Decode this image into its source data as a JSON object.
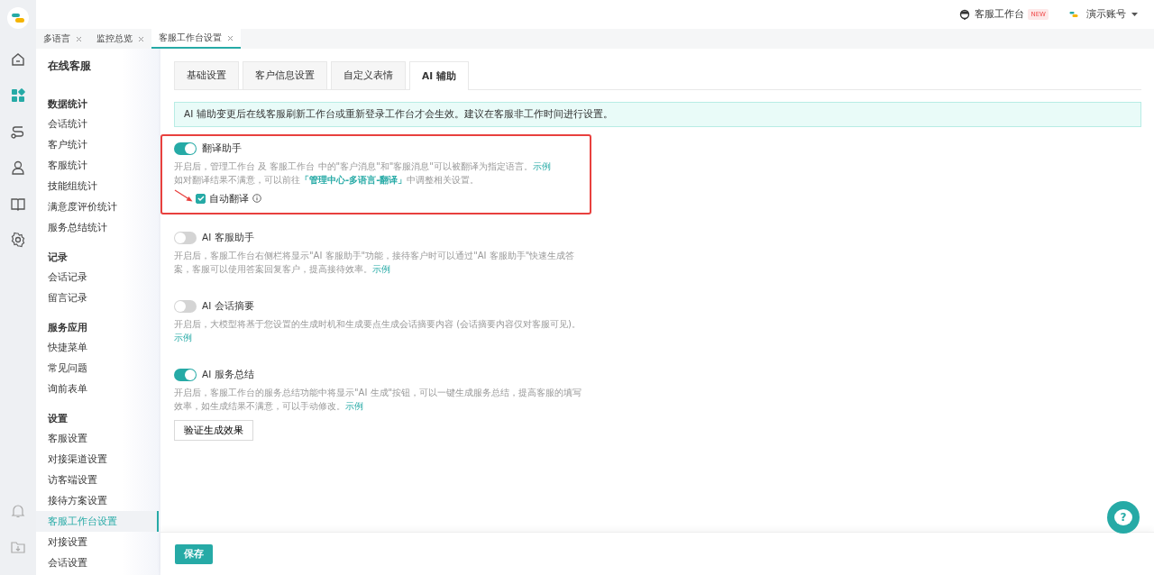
{
  "header": {
    "workbench": {
      "label": "客服工作台",
      "badge": "NEW"
    },
    "account": {
      "label": "演示账号"
    }
  },
  "rail": [
    {
      "kind": "home",
      "selected": false
    },
    {
      "kind": "apps",
      "selected": true
    },
    {
      "kind": "flow",
      "selected": false
    },
    {
      "kind": "person",
      "selected": false
    },
    {
      "kind": "book",
      "selected": false
    },
    {
      "kind": "gear",
      "selected": false
    }
  ],
  "rail_bottom": [
    {
      "kind": "bell"
    },
    {
      "kind": "download"
    }
  ],
  "page_tabs": [
    {
      "label": "多语言",
      "selected": false
    },
    {
      "label": "监控总览",
      "selected": false
    },
    {
      "label": "客服工作台设置",
      "selected": true
    }
  ],
  "sidebar": {
    "title": "在线客服",
    "groups": [
      {
        "title": "数据统计",
        "items": [
          {
            "label": "会话统计",
            "selected": false
          },
          {
            "label": "客户统计",
            "selected": false
          },
          {
            "label": "客服统计",
            "selected": false
          },
          {
            "label": "技能组统计",
            "selected": false
          },
          {
            "label": "满意度评价统计",
            "selected": false
          },
          {
            "label": "服务总结统计",
            "selected": false
          }
        ]
      },
      {
        "title": "记录",
        "items": [
          {
            "label": "会话记录",
            "selected": false
          },
          {
            "label": "留言记录",
            "selected": false
          }
        ]
      },
      {
        "title": "服务应用",
        "items": [
          {
            "label": "快捷菜单",
            "selected": false
          },
          {
            "label": "常见问题",
            "selected": false
          },
          {
            "label": "询前表单",
            "selected": false
          }
        ]
      },
      {
        "title": "设置",
        "items": [
          {
            "label": "客服设置",
            "selected": false
          },
          {
            "label": "对接渠道设置",
            "selected": false
          },
          {
            "label": "访客端设置",
            "selected": false
          },
          {
            "label": "接待方案设置",
            "selected": false
          },
          {
            "label": "客服工作台设置",
            "selected": true
          },
          {
            "label": "对接设置",
            "selected": false
          },
          {
            "label": "会话设置",
            "selected": false
          }
        ]
      }
    ]
  },
  "tabs": [
    {
      "label": "基础设置",
      "selected": false
    },
    {
      "label": "客户信息设置",
      "selected": false
    },
    {
      "label": "自定义表情",
      "selected": false
    },
    {
      "label": "AI 辅助",
      "selected": true
    }
  ],
  "notice": "AI 辅助变更后在线客服刷新工作台或重新登录工作台才会生效。建议在客服非工作时间进行设置。",
  "features": [
    {
      "title": "翻译助手",
      "on": true,
      "highlighted": true,
      "lines": [
        [
          {
            "kind": "text",
            "text": "开启后，管理工作台 及 客服工作台 中的\"客户消息\"和\"客服消息\"可以被翻译为指定语言。"
          },
          {
            "kind": "link",
            "text": "示例"
          }
        ],
        [
          {
            "kind": "text",
            "text": "如对翻译结果不满意，可以前往"
          },
          {
            "kind": "link",
            "text": "「管理中心-多语言-翻译」"
          },
          {
            "kind": "text",
            "text": "中调整相关设置。"
          }
        ]
      ],
      "option": {
        "label": "自动翻译",
        "checked": true
      }
    },
    {
      "title": "AI 客服助手",
      "on": false,
      "lines": [
        [
          {
            "kind": "text",
            "text": "开启后，客服工作台右侧栏将显示\"AI 客服助手\"功能，接待客户时可以通过\"AI 客服助手\"快速生成答案，客服可以使用答案回复客户，提高接待效率。"
          },
          {
            "kind": "link",
            "text": "示例"
          }
        ]
      ]
    },
    {
      "title": "AI 会话摘要",
      "on": false,
      "lines": [
        [
          {
            "kind": "text",
            "text": "开启后，大模型将基于您设置的生成时机和生成要点生成会话摘要内容 (会话摘要内容仅对客服可见)。"
          },
          {
            "kind": "link",
            "text": "示例"
          }
        ]
      ]
    },
    {
      "title": "AI 服务总结",
      "on": true,
      "lines": [
        [
          {
            "kind": "text",
            "text": "开启后，客服工作台的服务总结功能中将显示\"AI 生成\"按钮，可以一键生成服务总结，提高客服的填写效率，如生成结果不满意，可以手动修改。"
          },
          {
            "kind": "link",
            "text": "示例"
          }
        ]
      ],
      "button": "验证生成效果"
    }
  ],
  "save_button": "保存",
  "help_button": "?"
}
